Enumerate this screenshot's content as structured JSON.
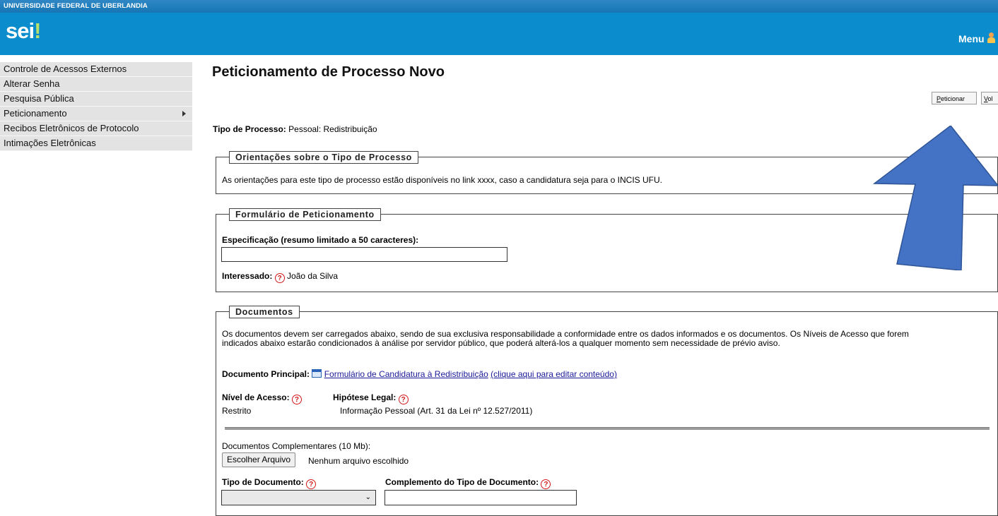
{
  "header": {
    "university": "UNIVERSIDADE FEDERAL DE UBERLANDIA",
    "logo_text": "sei",
    "logo_suffix": "!",
    "menu_label": "Menu"
  },
  "sidebar": {
    "items": [
      {
        "label": "Controle de Acessos Externos"
      },
      {
        "label": "Alterar Senha"
      },
      {
        "label": "Pesquisa Pública"
      },
      {
        "label": "Peticionamento"
      },
      {
        "label": "Recibos Eletrônicos de Protocolo"
      },
      {
        "label": "Intimações Eletrônicas"
      }
    ]
  },
  "page": {
    "title": "Peticionamento de Processo Novo",
    "buttons": {
      "peticionar_first": "P",
      "peticionar_rest": "eticionar",
      "voltar_first": "V",
      "voltar_rest": "ol"
    },
    "tipo_label": "Tipo de Processo:",
    "tipo_value": "Pessoal: Redistribuição"
  },
  "orientacoes": {
    "legend": "Orientações sobre o Tipo de Processo",
    "text": "As orientações para este tipo de processo estão disponíveis no link xxxx, caso a candidatura seja para o INCIS UFU."
  },
  "formulario": {
    "legend": "Formulário de Peticionamento",
    "especificacao_label": "Especificação (resumo limitado a 50 caracteres):",
    "especificacao_value": "",
    "interessado_label": "Interessado:",
    "interessado_value": "João da Silva"
  },
  "documentos": {
    "legend": "Documentos",
    "intro_line1": "Os documentos devem ser carregados abaixo, sendo de sua exclusiva responsabilidade a conformidade entre os dados informados e os documentos. Os Níveis de Acesso que forem",
    "intro_line2": "indicados abaixo estarão condicionados à análise por servidor público, que poderá alterá-los a qualquer momento sem necessidade de prévio aviso.",
    "principal_label": "Documento Principal:",
    "principal_link": "Formulário de Candidatura à Redistribuição",
    "principal_edit": "(clique aqui para editar conteúdo)",
    "nivel_label": "Nível de Acesso:",
    "nivel_value": "Restrito",
    "hipotese_label": "Hipótese Legal:",
    "hipotese_value": "Informação Pessoal (Art. 31 da Lei nº 12.527/2011)",
    "complementares_label": "Documentos Complementares (10 Mb):",
    "file_button": "Escolher Arquivo",
    "file_status": "Nenhum arquivo escolhido",
    "tipo_doc_label": "Tipo de Documento:",
    "tipo_doc_value": "",
    "complemento_label": "Complemento do Tipo de Documento:",
    "complemento_value": ""
  },
  "help_glyph": "?",
  "colors": {
    "header_bg": "#0a8ccd",
    "annotation_arrow": "#4472c4"
  }
}
